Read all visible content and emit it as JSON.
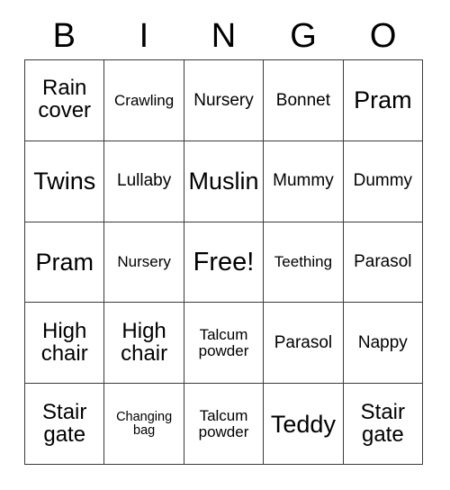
{
  "card": {
    "title": "BINGO",
    "header_letters": [
      "B",
      "I",
      "N",
      "G",
      "O"
    ],
    "grid_size": "5x5",
    "free_space": "Free!",
    "colors": {
      "background": "#ffffff",
      "text": "#000000",
      "border": "#3a3a3a"
    },
    "rows": [
      [
        {
          "text": "Rain\ncover",
          "size": "lg"
        },
        {
          "text": "Crawling",
          "size": "sm"
        },
        {
          "text": "Nursery",
          "size": "md"
        },
        {
          "text": "Bonnet",
          "size": "md"
        },
        {
          "text": "Pram",
          "size": "xl"
        }
      ],
      [
        {
          "text": "Twins",
          "size": "xl"
        },
        {
          "text": "Lullaby",
          "size": "md"
        },
        {
          "text": "Muslin",
          "size": "xl"
        },
        {
          "text": "Mummy",
          "size": "md"
        },
        {
          "text": "Dummy",
          "size": "md"
        }
      ],
      [
        {
          "text": "Pram",
          "size": "xl"
        },
        {
          "text": "Nursery",
          "size": "sm"
        },
        {
          "text": "Free!",
          "size": "xxl"
        },
        {
          "text": "Teething",
          "size": "sm"
        },
        {
          "text": "Parasol",
          "size": "md"
        }
      ],
      [
        {
          "text": "High\nchair",
          "size": "lg"
        },
        {
          "text": "High\nchair",
          "size": "lg"
        },
        {
          "text": "Talcum\npowder",
          "size": "sm"
        },
        {
          "text": "Parasol",
          "size": "md"
        },
        {
          "text": "Nappy",
          "size": "md"
        }
      ],
      [
        {
          "text": "Stair\ngate",
          "size": "lg"
        },
        {
          "text": "Changing\nbag",
          "size": "xs"
        },
        {
          "text": "Talcum\npowder",
          "size": "sm"
        },
        {
          "text": "Teddy",
          "size": "xl"
        },
        {
          "text": "Stair\ngate",
          "size": "lg"
        }
      ]
    ]
  }
}
